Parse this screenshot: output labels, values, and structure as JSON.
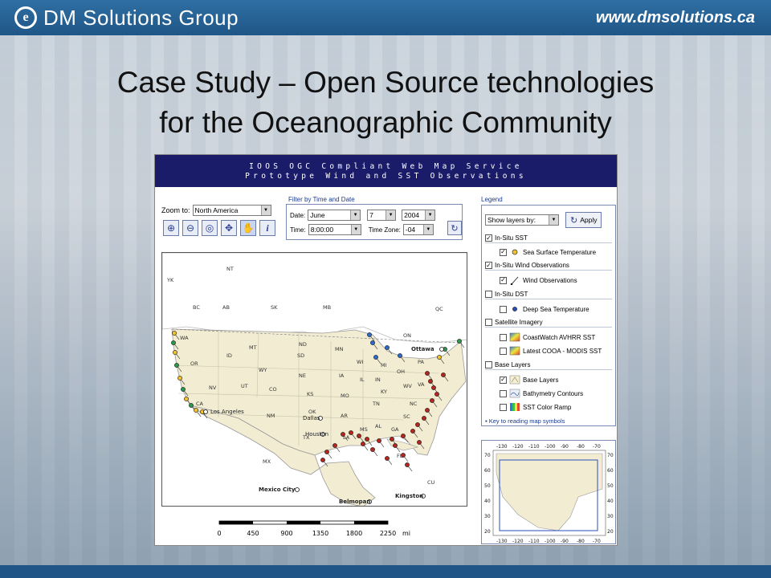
{
  "slide": {
    "brand_name": "DM Solutions Group",
    "brand_letter": "e",
    "website": "www.dmsolutions.ca",
    "title_line1": "Case Study – Open Source technologies",
    "title_line2": "for the Oceanographic Community"
  },
  "app": {
    "header_line1": "IOOS OGC Compliant Web Map Service",
    "header_line2": "Prototype Wind and SST Observations",
    "zoom_label": "Zoom to:",
    "zoom_value": "North America",
    "tools": [
      "zoom-in",
      "zoom-out",
      "zoom-extent",
      "pan",
      "hand",
      "info"
    ],
    "filter": {
      "title": "Filter by Time and Date",
      "date_label": "Date:",
      "month": "June",
      "day": "7",
      "year": "2004",
      "time_label": "Time:",
      "time": "8:00:00",
      "tz_label": "Time Zone:",
      "tz": "-04"
    },
    "legend": {
      "title": "Legend",
      "show_layers": "Show layers by:",
      "apply": "Apply",
      "groups": [
        {
          "label": "In-Situ SST",
          "checked": true,
          "items": [
            {
              "label": "Sea Surface Temperature",
              "checked": true
            }
          ]
        },
        {
          "label": "In-Situ Wind Observations",
          "checked": true,
          "items": [
            {
              "label": "Wind Observations",
              "checked": true
            }
          ]
        },
        {
          "label": "In-Situ DST",
          "checked": false,
          "items": [
            {
              "label": "Deep Sea Temperature",
              "checked": false
            }
          ]
        },
        {
          "label": "Satellite Imagery",
          "checked": false,
          "items": [
            {
              "label": "CoastWatch AVHRR SST",
              "checked": false
            },
            {
              "label": "Latest COOA - MODIS SST",
              "checked": false
            }
          ]
        },
        {
          "label": "Base Layers",
          "checked": false,
          "items": [
            {
              "label": "Base Layers",
              "checked": true
            },
            {
              "label": "Bathymetry Contours",
              "checked": false
            },
            {
              "label": "SST Color Ramp",
              "checked": false
            }
          ]
        }
      ],
      "key_link": "Key to reading map symbols"
    },
    "map": {
      "labels": [
        "NT",
        "YK",
        "BC",
        "AB",
        "SK",
        "MB",
        "QC",
        "ON",
        "WA",
        "MT",
        "ND",
        "MN",
        "OR",
        "ID",
        "WY",
        "SD",
        "WI",
        "MI",
        "NE",
        "IA",
        "NV",
        "UT",
        "CO",
        "KS",
        "MO",
        "IL",
        "IN",
        "OH",
        "PA",
        "CA",
        "NM",
        "OK",
        "AR",
        "TN",
        "KY",
        "WV",
        "VA",
        "NC",
        "SC",
        "TX",
        "LA",
        "MS",
        "AL",
        "GA",
        "FL",
        "MX",
        "CU"
      ],
      "cities": [
        "Ottawa",
        "Los Angeles",
        "Dallas",
        "Houston",
        "Mexico City",
        "Belmopan",
        "Kingston"
      ],
      "scale_ticks": [
        "0",
        "450",
        "900",
        "1350",
        "1800",
        "2250"
      ],
      "scale_unit": "mi"
    },
    "overview": {
      "top_ticks": [
        "-130",
        "-120",
        "-110",
        "-100",
        "-90",
        "-80",
        "-70"
      ],
      "bottom_ticks": [
        "-130",
        "-120",
        "-110",
        "-100",
        "-90",
        "-80",
        "-70"
      ],
      "left_ticks": [
        "70",
        "60",
        "50",
        "40",
        "30",
        "20"
      ],
      "right_ticks": [
        "70",
        "60",
        "50",
        "40",
        "30",
        "20"
      ]
    }
  }
}
